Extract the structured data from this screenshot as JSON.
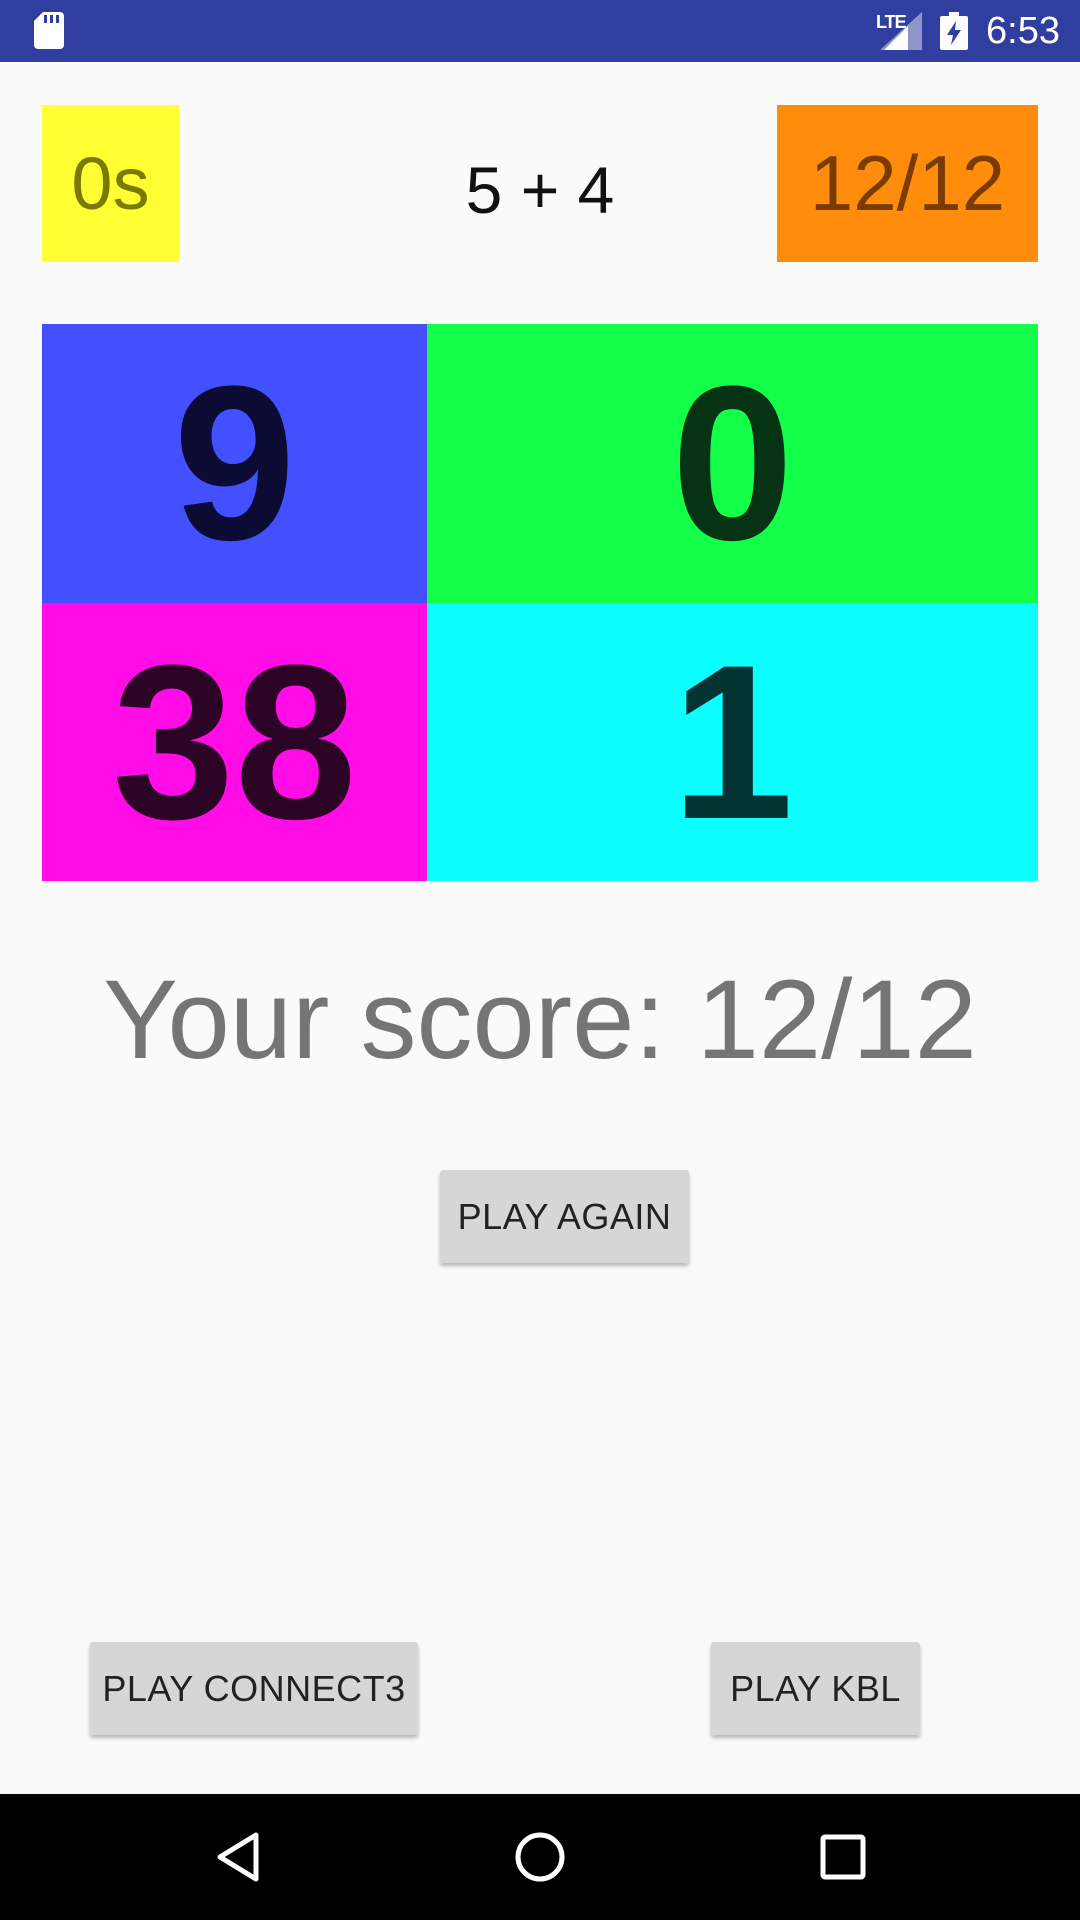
{
  "status_bar": {
    "network": "LTE",
    "time": "6:53",
    "icons": [
      "sd-card-icon",
      "signal-icon",
      "battery-charging-icon"
    ],
    "background": "#303f9f"
  },
  "game": {
    "timer": "0s",
    "question": "5 + 4",
    "score": "12/12",
    "answers": [
      "9",
      "0",
      "38",
      "1"
    ],
    "answer_colors": [
      "#4250ff",
      "#14ff4a",
      "#ff0ce6",
      "#0bffff"
    ],
    "timer_color": "#ffff33",
    "score_color": "#ff8c0a",
    "result": "Your score: 12/12"
  },
  "buttons": {
    "play_again": "PLAY AGAIN",
    "play_connect3": "PLAY CONNECT3",
    "play_kbl": "PLAY KBL"
  },
  "nav_bar": {
    "icons": [
      "back-icon",
      "home-icon",
      "recent-apps-icon"
    ]
  }
}
